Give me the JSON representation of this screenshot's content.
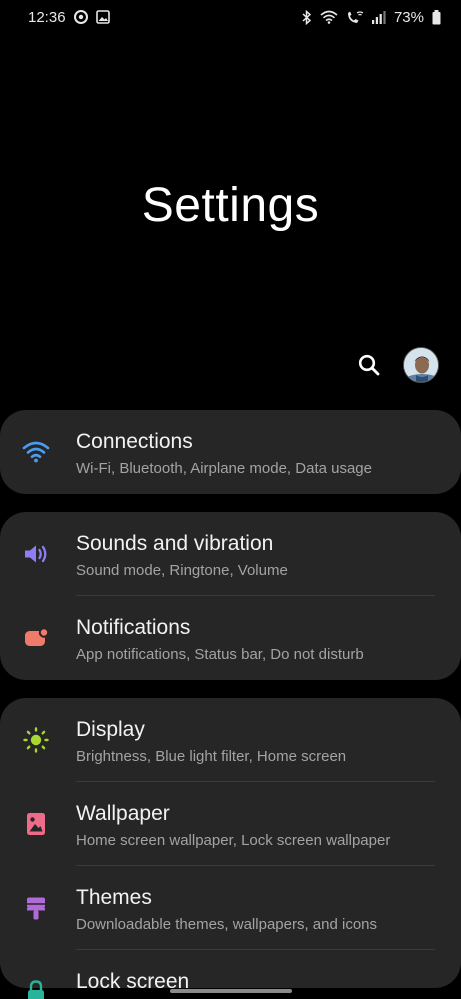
{
  "status_bar": {
    "time": "12:36",
    "battery": "73%",
    "icons": [
      "media-icon",
      "gallery-icon",
      "bluetooth-icon",
      "wifi-icon",
      "wifi-call-icon",
      "signal-icon",
      "battery-icon"
    ]
  },
  "header": {
    "title": "Settings",
    "search_icon": "search-icon",
    "avatar": "avatar"
  },
  "cards": [
    {
      "items": [
        {
          "title": "Connections",
          "subtitle": "Wi-Fi, Bluetooth, Airplane mode, Data usage",
          "icon": "wifi-icon",
          "icon_color": "#4a9cf0"
        }
      ]
    },
    {
      "items": [
        {
          "title": "Sounds and vibration",
          "subtitle": "Sound mode, Ringtone, Volume",
          "icon": "volume-icon",
          "icon_color": "#8d7ef5"
        },
        {
          "title": "Notifications",
          "subtitle": "App notifications, Status bar, Do not disturb",
          "icon": "notification-icon",
          "icon_color": "#f07b6b"
        }
      ]
    },
    {
      "items": [
        {
          "title": "Display",
          "subtitle": "Brightness, Blue light filter, Home screen",
          "icon": "brightness-icon",
          "icon_color": "#a6d82f"
        },
        {
          "title": "Wallpaper",
          "subtitle": "Home screen wallpaper, Lock screen wallpaper",
          "icon": "wallpaper-icon",
          "icon_color": "#ef6b8a"
        },
        {
          "title": "Themes",
          "subtitle": "Downloadable themes, wallpapers, and icons",
          "icon": "themes-icon",
          "icon_color": "#b06bd8"
        },
        {
          "title": "Lock screen",
          "subtitle": "",
          "icon": "lock-icon",
          "icon_color": "#27b49a"
        }
      ]
    }
  ],
  "colors": {
    "background": "#000000",
    "card": "#262626",
    "title_text": "#f2f2f2",
    "subtitle_text": "#a3a3a3"
  }
}
